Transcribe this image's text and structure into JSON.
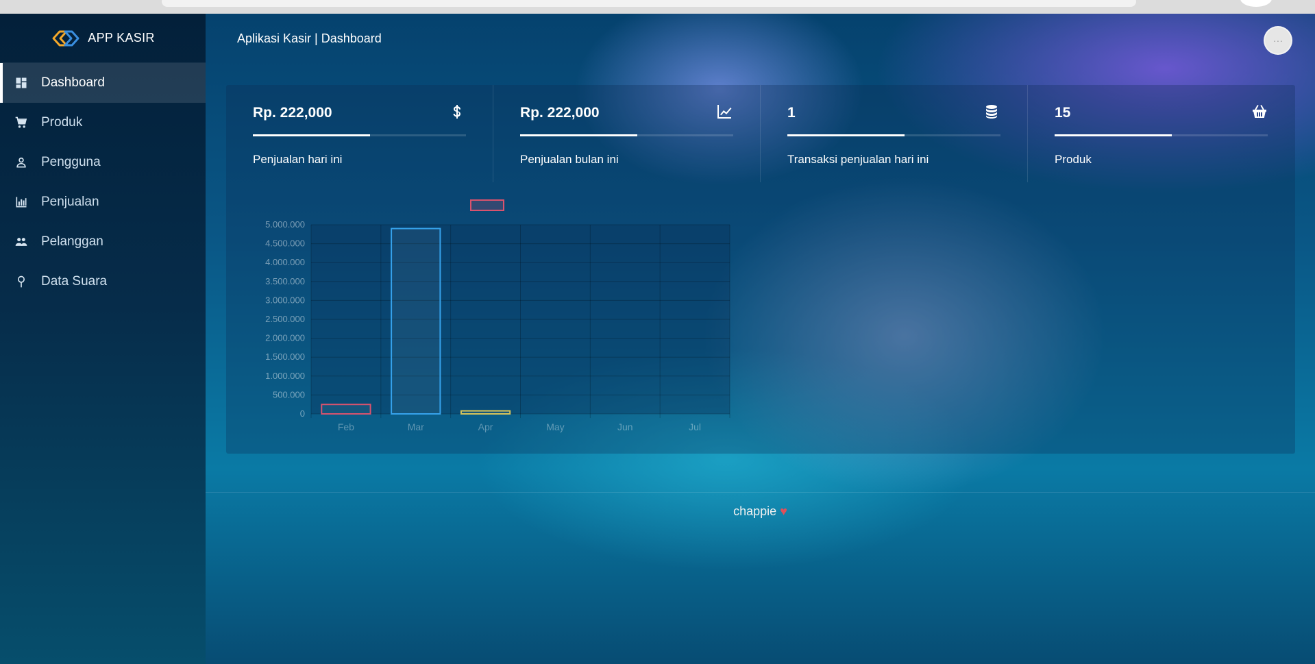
{
  "brand": {
    "name": "APP KASIR"
  },
  "header": {
    "title": "Aplikasi Kasir | Dashboard",
    "menu_button": "···"
  },
  "sidebar": {
    "items": [
      {
        "label": "Dashboard",
        "icon": "dashboard-icon",
        "active": true
      },
      {
        "label": "Produk",
        "icon": "cart-icon"
      },
      {
        "label": "Pengguna",
        "icon": "user-icon"
      },
      {
        "label": "Penjualan",
        "icon": "bar-chart-icon"
      },
      {
        "label": "Pelanggan",
        "icon": "people-icon"
      },
      {
        "label": "Data Suara",
        "icon": "pin-icon"
      }
    ]
  },
  "stats": [
    {
      "value": "Rp. 222,000",
      "label": "Penjualan hari ini",
      "icon": "dollar-icon",
      "progress": 0.55
    },
    {
      "value": "Rp. 222,000",
      "label": "Penjualan bulan ini",
      "icon": "trend-icon",
      "progress": 0.55
    },
    {
      "value": "1",
      "label": "Transaksi penjualan hari ini",
      "icon": "database-icon",
      "progress": 0.55
    },
    {
      "value": "15",
      "label": "Produk",
      "icon": "basket-icon",
      "progress": 0.55
    }
  ],
  "chart_data": {
    "type": "bar",
    "categories": [
      "Feb",
      "Mar",
      "Apr",
      "May",
      "Jun",
      "Jul"
    ],
    "values": [
      250000,
      4900000,
      80000,
      0,
      0,
      0
    ],
    "bar_colors": [
      "#d9536e",
      "#36a2eb",
      "#d8c55a",
      "#4bc0c0",
      "#9966ff",
      "#ff9f40"
    ],
    "yticks": [
      "5.000.000",
      "4.500.000",
      "4.000.000",
      "3.500.000",
      "3.000.000",
      "2.500.000",
      "2.000.000",
      "1.500.000",
      "1.000.000",
      "500.000",
      "0"
    ],
    "ylim": [
      0,
      5000000
    ],
    "legend": "top",
    "grid": true
  },
  "footer": {
    "text": "chappie",
    "heart": "♥"
  }
}
